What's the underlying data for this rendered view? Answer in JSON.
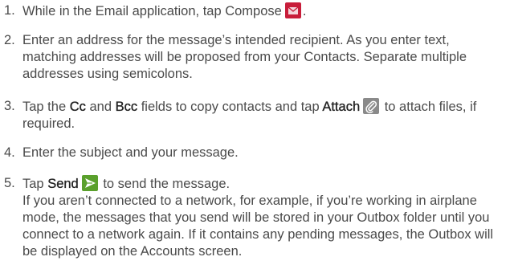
{
  "steps": [
    {
      "number": "1.",
      "text": "While in the Email application, tap Compose",
      "icon": "compose-icon",
      "tail": "."
    },
    {
      "number": "2.",
      "text": "Enter an address for the message’s intended recipient. As you enter text, matching addresses will be proposed from your Contacts. Separate multiple addresses using semicolons."
    },
    {
      "number": "3.",
      "pre": "Tap the ",
      "cc": "Cc",
      "and": " and ",
      "bcc": "Bcc",
      "mid": " fields to copy contacts and tap ",
      "attach": "Attach",
      "icon": "paperclip-icon",
      "post": " to attach files, if required."
    },
    {
      "number": "4.",
      "text": "Enter the subject and your message."
    },
    {
      "number": "5.",
      "pre": "Tap ",
      "send": "Send",
      "icon": "send-icon",
      "post": " to send the message.",
      "note": "If you aren’t connected to a network, for example, if you’re working in airplane mode, the messages that you send will be stored in your Outbox folder until you connect to a network again. If it contains any pending messages, the Outbox will be displayed on the Accounts screen."
    }
  ],
  "colors": {
    "text": "#4a4a4a",
    "icon_bg_compose": "#c81d3a",
    "icon_bg_attach": "#8a8a8a",
    "icon_bg_send": "#5aa02c"
  }
}
